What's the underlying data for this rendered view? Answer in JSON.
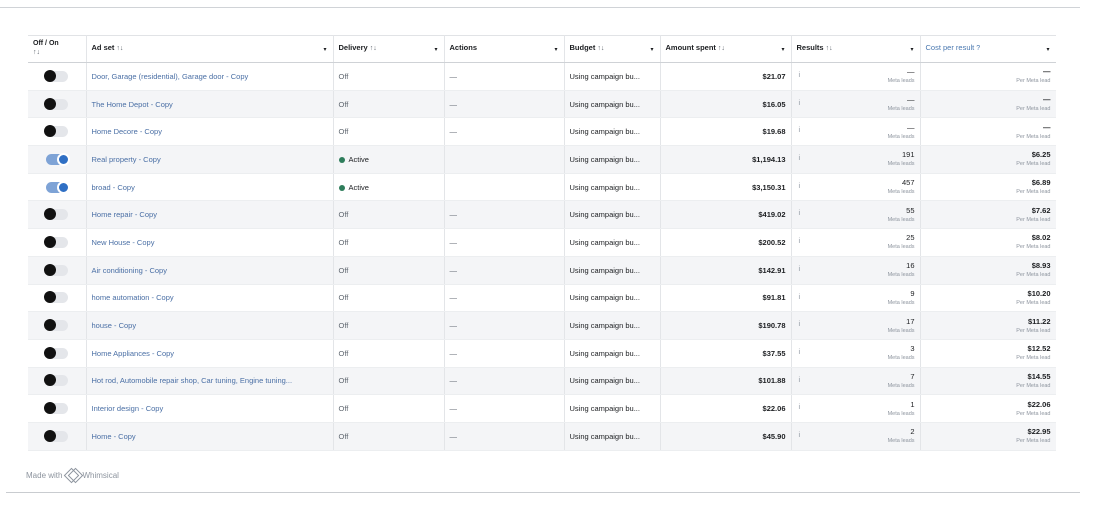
{
  "columns": {
    "toggle": "Off / On",
    "adset": "Ad set",
    "delivery": "Delivery",
    "actions": "Actions",
    "budget": "Budget",
    "amount": "Amount spent",
    "results": "Results",
    "cpr": "Cost per result",
    "sort_glyph": "↑↓",
    "caret_glyph": "▾",
    "help_glyph": "?"
  },
  "rows": [
    {
      "on": false,
      "adset": "Door, Garage (residential), Garage door - Copy",
      "delivery": "Off",
      "actions": "—",
      "budget": "Using campaign bu...",
      "amount": "$21.07",
      "result": "—",
      "result_sub": "Meta leads",
      "cpr": "—",
      "cpr_sub": "Per Meta lead"
    },
    {
      "on": false,
      "adset": "The Home Depot - Copy",
      "delivery": "Off",
      "actions": "—",
      "budget": "Using campaign bu...",
      "amount": "$16.05",
      "result": "—",
      "result_sub": "Meta leads",
      "cpr": "—",
      "cpr_sub": "Per Meta lead"
    },
    {
      "on": false,
      "adset": "Home Decore - Copy",
      "delivery": "Off",
      "actions": "—",
      "budget": "Using campaign bu...",
      "amount": "$19.68",
      "result": "—",
      "result_sub": "Meta leads",
      "cpr": "—",
      "cpr_sub": "Per Meta lead"
    },
    {
      "on": true,
      "adset": "Real property - Copy",
      "delivery": "Active",
      "actions": "",
      "budget": "Using campaign bu...",
      "amount": "$1,194.13",
      "result": "191",
      "result_sub": "Meta leads",
      "cpr": "$6.25",
      "cpr_sub": "Per Meta lead"
    },
    {
      "on": true,
      "adset": "broad - Copy",
      "delivery": "Active",
      "actions": "",
      "budget": "Using campaign bu...",
      "amount": "$3,150.31",
      "result": "457",
      "result_sub": "Meta leads",
      "cpr": "$6.89",
      "cpr_sub": "Per Meta lead"
    },
    {
      "on": false,
      "adset": "Home repair - Copy",
      "delivery": "Off",
      "actions": "—",
      "budget": "Using campaign bu...",
      "amount": "$419.02",
      "result": "55",
      "result_sub": "Meta leads",
      "cpr": "$7.62",
      "cpr_sub": "Per Meta lead"
    },
    {
      "on": false,
      "adset": "New House - Copy",
      "delivery": "Off",
      "actions": "—",
      "budget": "Using campaign bu...",
      "amount": "$200.52",
      "result": "25",
      "result_sub": "Meta leads",
      "cpr": "$8.02",
      "cpr_sub": "Per Meta lead"
    },
    {
      "on": false,
      "adset": "Air conditioning - Copy",
      "delivery": "Off",
      "actions": "—",
      "budget": "Using campaign bu...",
      "amount": "$142.91",
      "result": "16",
      "result_sub": "Meta leads",
      "cpr": "$8.93",
      "cpr_sub": "Per Meta lead"
    },
    {
      "on": false,
      "adset": "home automation - Copy",
      "delivery": "Off",
      "actions": "—",
      "budget": "Using campaign bu...",
      "amount": "$91.81",
      "result": "9",
      "result_sub": "Meta leads",
      "cpr": "$10.20",
      "cpr_sub": "Per Meta lead"
    },
    {
      "on": false,
      "adset": "house - Copy",
      "delivery": "Off",
      "actions": "—",
      "budget": "Using campaign bu...",
      "amount": "$190.78",
      "result": "17",
      "result_sub": "Meta leads",
      "cpr": "$11.22",
      "cpr_sub": "Per Meta lead"
    },
    {
      "on": false,
      "adset": "Home Appliances - Copy",
      "delivery": "Off",
      "actions": "—",
      "budget": "Using campaign bu...",
      "amount": "$37.55",
      "result": "3",
      "result_sub": "Meta leads",
      "cpr": "$12.52",
      "cpr_sub": "Per Meta lead"
    },
    {
      "on": false,
      "adset": "Hot rod, Automobile repair shop, Car tuning, Engine tuning...",
      "delivery": "Off",
      "actions": "—",
      "budget": "Using campaign bu...",
      "amount": "$101.88",
      "result": "7",
      "result_sub": "Meta leads",
      "cpr": "$14.55",
      "cpr_sub": "Per Meta lead"
    },
    {
      "on": false,
      "adset": "Interior design - Copy",
      "delivery": "Off",
      "actions": "—",
      "budget": "Using campaign bu...",
      "amount": "$22.06",
      "result": "1",
      "result_sub": "Meta leads",
      "cpr": "$22.06",
      "cpr_sub": "Per Meta lead"
    },
    {
      "on": false,
      "adset": "Home - Copy",
      "delivery": "Off",
      "actions": "—",
      "budget": "Using campaign bu...",
      "amount": "$45.90",
      "result": "2",
      "result_sub": "Meta leads",
      "cpr": "$22.95",
      "cpr_sub": "Per Meta lead"
    }
  ],
  "results_info_glyph": "i",
  "footer": {
    "made_with": "Made with",
    "brand": "Whimsical"
  }
}
